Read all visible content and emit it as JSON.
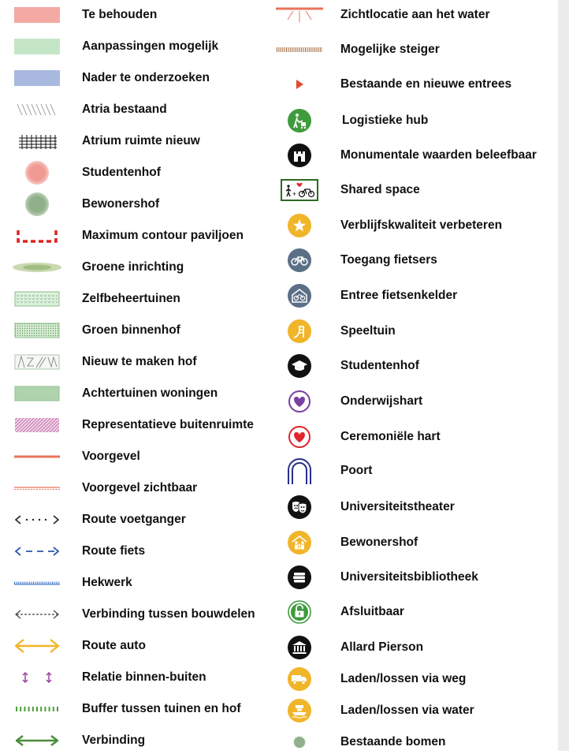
{
  "legend": {
    "left": [
      {
        "label": "Te behouden",
        "color": "#f4a9a4"
      },
      {
        "label": "Aanpassingen mogelijk",
        "color": "#c4e6c6"
      },
      {
        "label": "Nader te onderzoeken",
        "color": "#a9b9df"
      },
      {
        "label": "Atria bestaand"
      },
      {
        "label": "Atrium ruimte nieuw"
      },
      {
        "label": "Studentenhof",
        "color": "#f19a93"
      },
      {
        "label": "Bewonershof",
        "color": "#8fb08a"
      },
      {
        "label": "Maximum contour paviljoen",
        "color": "#e0201f"
      },
      {
        "label": "Groene inrichting",
        "color": "#a9c08c"
      },
      {
        "label": "Zelfbeheertuinen"
      },
      {
        "label": "Groen binnenhof"
      },
      {
        "label": "Nieuw te maken hof"
      },
      {
        "label": "Achtertuinen woningen"
      },
      {
        "label": "Representatieve buitenruimte",
        "color": "#b0448f"
      },
      {
        "label": "Voorgevel",
        "color": "#e8735a"
      },
      {
        "label": "Voorgevel zichtbaar",
        "color": "#e8735a"
      },
      {
        "label": "Route voetganger"
      },
      {
        "label": "Route fiets",
        "color": "#2e5bb0"
      },
      {
        "label": "Hekwerk",
        "color": "#3b6fc4"
      },
      {
        "label": "Verbinding tussen bouwdelen"
      },
      {
        "label": "Route auto",
        "color": "#f1b52a"
      },
      {
        "label": "Relatie binnen-buiten",
        "color": "#9c3fa3"
      },
      {
        "label": "Buffer tussen tuinen en hof",
        "color": "#4a9e3a"
      },
      {
        "label": "Verbinding",
        "color": "#4a8c3a"
      }
    ],
    "right": [
      {
        "label": "Zichtlocatie aan het water",
        "color": "#e8735a"
      },
      {
        "label": "Mogelijke steiger",
        "color": "#a0673a"
      },
      {
        "label": "Bestaande en nieuwe entrees",
        "color": "#e24a2c"
      },
      {
        "label": "Logistieke hub",
        "icon": "worker-cart-icon",
        "color": "#3f9b3c"
      },
      {
        "label": "Monumentale waarden beleefbaar",
        "icon": "castle-icon"
      },
      {
        "label": "Shared space",
        "icon": "pedestrian-bike-icon"
      },
      {
        "label": "Verblijfskwaliteit verbeteren",
        "icon": "star-icon",
        "color": "#f1b52a"
      },
      {
        "label": "Toegang fietsers",
        "icon": "bicycle-icon",
        "color": "#5b6f86"
      },
      {
        "label": "Entree fietsenkelder",
        "icon": "bicycle-house-icon",
        "color": "#5b6f86"
      },
      {
        "label": "Speeltuin",
        "icon": "slide-icon",
        "color": "#f1b52a"
      },
      {
        "label": "Studentenhof",
        "icon": "graduation-cap-icon"
      },
      {
        "label": "Onderwijshart",
        "icon": "heart-icon",
        "color": "#7a3fa3"
      },
      {
        "label": "Ceremoniële hart",
        "icon": "heart-icon",
        "color": "#e0252b"
      },
      {
        "label": "Poort",
        "icon": "arch-icon",
        "color": "#2a2f8a"
      },
      {
        "label": "Universiteitstheater",
        "icon": "theater-masks-icon"
      },
      {
        "label": "Bewonershof",
        "icon": "family-icon",
        "color": "#f1b52a"
      },
      {
        "label": "Universiteitsbibliotheek",
        "icon": "books-icon"
      },
      {
        "label": "Afsluitbaar",
        "icon": "padlock-icon",
        "color": "#3f9b3c"
      },
      {
        "label": "Allard Pierson",
        "icon": "museum-icon"
      },
      {
        "label": "Laden/lossen via weg",
        "icon": "truck-icon",
        "color": "#f1b52a"
      },
      {
        "label": "Laden/lossen via water",
        "icon": "boat-icon",
        "color": "#f1b52a"
      },
      {
        "label": "Bestaande bomen",
        "icon": "tree-icon",
        "color": "#8fb08a"
      }
    ]
  }
}
